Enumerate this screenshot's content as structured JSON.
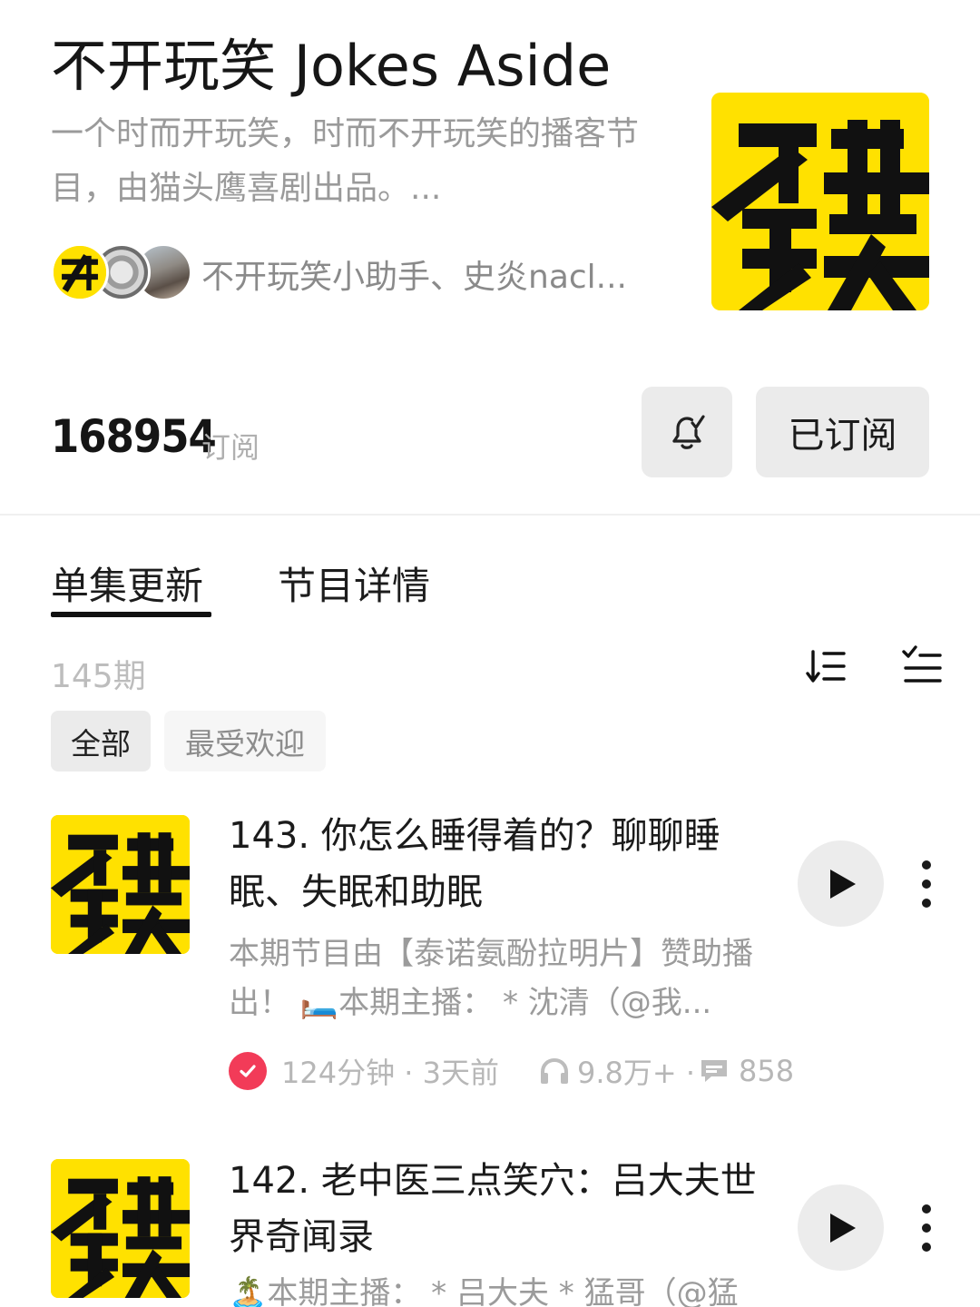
{
  "podcast": {
    "title": "不开玩笑 Jokes Aside",
    "description": "一个时而开玩笑，时而不开玩笑的播客节目，由猫头鹰喜剧出品。...",
    "hosts": "不开玩笑小助手、史炎nacl...",
    "cover_text_line1": "不开",
    "cover_text_line2": "玩笑"
  },
  "stats": {
    "subscriber_count": "168954",
    "subscriber_label": "订阅",
    "subscribed_label": "已订阅"
  },
  "tabs": [
    {
      "label": "单集更新",
      "active": true
    },
    {
      "label": "节目详情",
      "active": false
    }
  ],
  "episode_list": {
    "count_label": "145期",
    "filters": [
      {
        "label": "全部",
        "active": true
      },
      {
        "label": "最受欢迎",
        "active": false
      }
    ]
  },
  "episodes": [
    {
      "title": "143. 你怎么睡得着的？聊聊睡眠、失眠和助眠",
      "description": "本期节目由【泰诺氨酚拉明片】赞助播出！ 🛏️本期主播： * 沈清（@我...",
      "duration_time": "124分钟 · 3天前",
      "plays": "9.8万+ ·",
      "comments": "858",
      "played": true
    },
    {
      "title": "142. 老中医三点笑穴：吕大夫世界奇闻录",
      "description": "🏝️本期主播： * 吕大夫 * 猛哥（@猛",
      "played": false
    }
  ],
  "colors": {
    "brand_yellow": "#ffe100",
    "played_badge": "#f23b58",
    "button_gray": "#ebebeb"
  },
  "icons": {
    "bell": "bell-subscribe-icon",
    "sort": "sort-order-icon",
    "select": "multi-select-icon",
    "play": "play-icon",
    "more": "more-vertical-icon",
    "headphones": "headphones-icon",
    "comment": "comment-icon",
    "check": "check-icon"
  }
}
